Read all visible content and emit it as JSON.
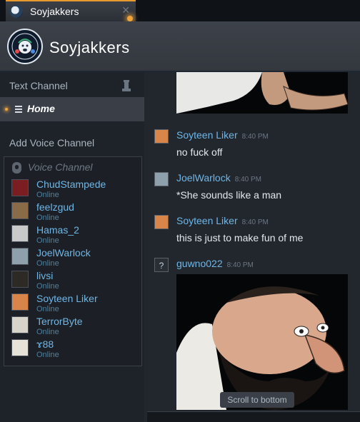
{
  "tab": {
    "title": "Soyjakkers",
    "close": "✕"
  },
  "header": {
    "title": "Soyjakkers"
  },
  "sidebar": {
    "text_channel_label": "Text Channel",
    "home_label": "Home",
    "add_voice_label": "Add Voice Channel",
    "voice_channel_label": "Voice Channel",
    "members": [
      {
        "name": "ChudStampede",
        "status": "Online",
        "avatar_color": "#7a1e22"
      },
      {
        "name": "feelzgud",
        "status": "Online",
        "avatar_color": "#8a6b48"
      },
      {
        "name": "Hamas_2",
        "status": "Online",
        "avatar_color": "#c9c9c9"
      },
      {
        "name": "JoelWarlock",
        "status": "Online",
        "avatar_color": "#8fa0ad"
      },
      {
        "name": "livsi",
        "status": "Online",
        "avatar_color": "#2d2a26"
      },
      {
        "name": "Soyteen Liker",
        "status": "Online",
        "avatar_color": "#d9854a"
      },
      {
        "name": "TerrorByte",
        "status": "Online",
        "avatar_color": "#d8d4cc"
      },
      {
        "name": "ɤ88",
        "status": "Online",
        "avatar_color": "#e6e2da"
      }
    ]
  },
  "chat": {
    "messages": [
      {
        "author": "Soyteen Liker",
        "time": "8:40 PM",
        "text": "no fuck off",
        "avatar_color": "#d9854a"
      },
      {
        "author": "JoelWarlock",
        "time": "8:40 PM",
        "text": "*She sounds like a man",
        "avatar_color": "#8fa0ad"
      },
      {
        "author": "Soyteen Liker",
        "time": "8:40 PM",
        "text": "this is just to make fun of me",
        "avatar_color": "#d9854a"
      },
      {
        "author": "guwno022",
        "time": "8:40 PM",
        "text": "",
        "avatar_glyph": "?"
      }
    ],
    "scroll_to_bottom": "Scroll to bottom"
  },
  "colors": {
    "accent": "#f0a43a",
    "link": "#6fb6e6",
    "background": "#1b2838"
  }
}
